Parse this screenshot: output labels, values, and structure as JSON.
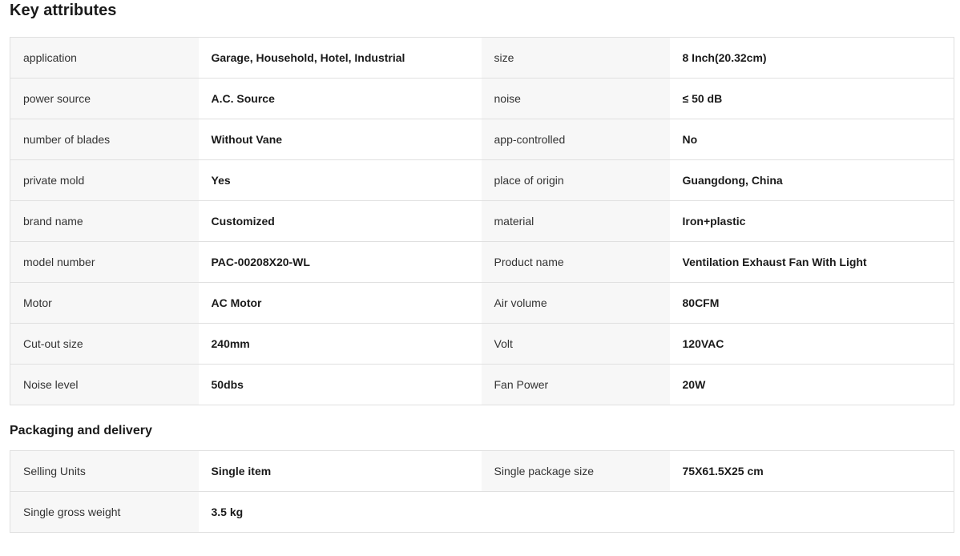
{
  "key_attributes": {
    "title": "Key attributes",
    "rows": [
      {
        "label1": "application",
        "value1": "Garage, Household, Hotel, Industrial",
        "label2": "size",
        "value2": "8 Inch(20.32cm)"
      },
      {
        "label1": "power source",
        "value1": "A.C. Source",
        "label2": "noise",
        "value2": "≤ 50 dB"
      },
      {
        "label1": "number of blades",
        "value1": "Without Vane",
        "label2": "app-controlled",
        "value2": "No"
      },
      {
        "label1": "private mold",
        "value1": "Yes",
        "label2": "place of origin",
        "value2": "Guangdong, China"
      },
      {
        "label1": "brand name",
        "value1": "Customized",
        "label2": "material",
        "value2": "Iron+plastic"
      },
      {
        "label1": "model number",
        "value1": "PAC-00208X20-WL",
        "label2": "Product name",
        "value2": "Ventilation Exhaust Fan With Light"
      },
      {
        "label1": "Motor",
        "value1": "AC Motor",
        "label2": "Air volume",
        "value2": "80CFM"
      },
      {
        "label1": "Cut-out size",
        "value1": "240mm",
        "label2": "Volt",
        "value2": "120VAC"
      },
      {
        "label1": "Noise level",
        "value1": "50dbs",
        "label2": "Fan Power",
        "value2": "20W"
      }
    ]
  },
  "packaging": {
    "title": "Packaging and delivery",
    "rows": [
      {
        "label1": "Selling Units",
        "value1": "Single item",
        "label2": "Single package size",
        "value2": "75X61.5X25 cm"
      },
      {
        "label1": "Single gross weight",
        "value1": "3.5 kg",
        "label2": "",
        "value2": ""
      }
    ]
  },
  "colors": {
    "label_bg": "#f7f7f7",
    "value_bg": "#ffffff",
    "border": "#e0e0e0",
    "text": "#222222"
  }
}
